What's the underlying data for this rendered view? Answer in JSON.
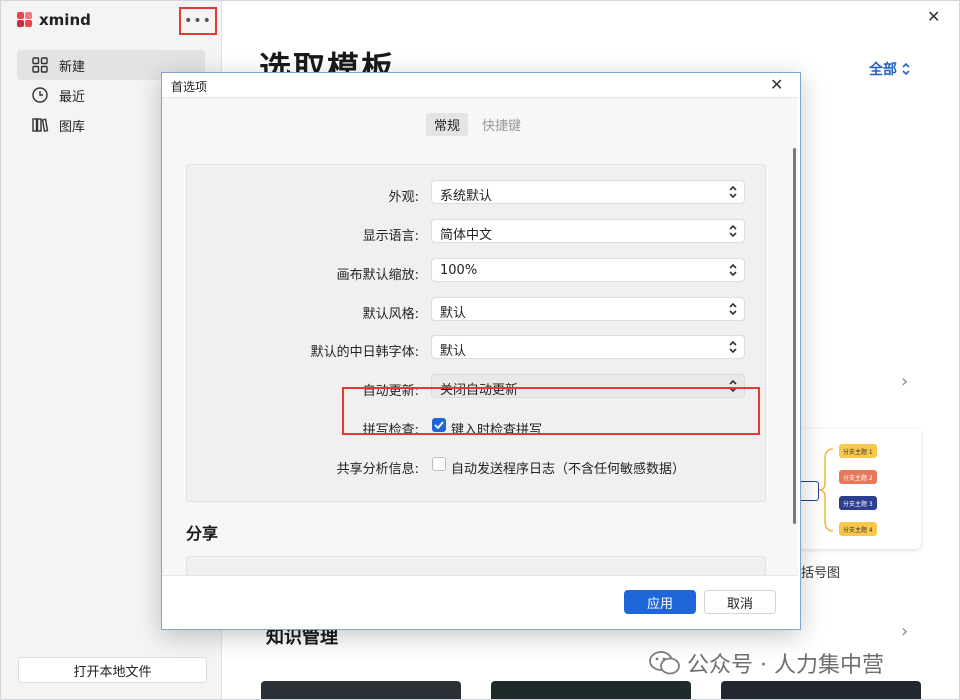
{
  "app": {
    "brand": "xmind",
    "more_button": "•••",
    "open_local_file": "打开本地文件",
    "nav": [
      {
        "label": "新建",
        "icon": "grid-icon",
        "active": true
      },
      {
        "label": "最近",
        "icon": "clock-icon",
        "active": false
      },
      {
        "label": "图库",
        "icon": "library-icon",
        "active": false
      }
    ]
  },
  "main": {
    "title": "选取模板",
    "filter_label": "全部",
    "card_caption": "括号图",
    "section_knowledge": "知识管理",
    "card_pills": [
      "分支主题 1",
      "分支主题 2",
      "分支主题 3",
      "分支主题 4"
    ]
  },
  "dialog": {
    "title": "首选项",
    "tabs": [
      {
        "label": "常规",
        "active": true
      },
      {
        "label": "快捷键",
        "active": false
      }
    ],
    "settings": [
      {
        "label": "外观:",
        "type": "select",
        "value": "系统默认"
      },
      {
        "label": "显示语言:",
        "type": "select",
        "value": "简体中文"
      },
      {
        "label": "画布默认缩放:",
        "type": "select",
        "value": "100%"
      },
      {
        "label": "默认风格:",
        "type": "select",
        "value": "默认"
      },
      {
        "label": "默认的中日韩字体:",
        "type": "select",
        "value": "默认"
      },
      {
        "label": "自动更新:",
        "type": "select",
        "value": "关闭自动更新",
        "highlighted": true
      },
      {
        "label": "拼写检查:",
        "type": "checkbox",
        "checked": true,
        "text": "键入时检查拼写"
      },
      {
        "label": "共享分析信息:",
        "type": "checkbox",
        "checked": false,
        "text": "自动发送程序日志（不含任何敏感数据）"
      }
    ],
    "share_heading": "分享",
    "apply_label": "应用",
    "cancel_label": "取消"
  },
  "watermark": "公众号 · 人力集中营",
  "colors": {
    "accent_blue": "#1f66d8",
    "highlight_red": "#e53935",
    "pill_yellow": "#f7c84a",
    "pill_orange": "#e8785a",
    "pill_navy": "#2c3e8f"
  }
}
